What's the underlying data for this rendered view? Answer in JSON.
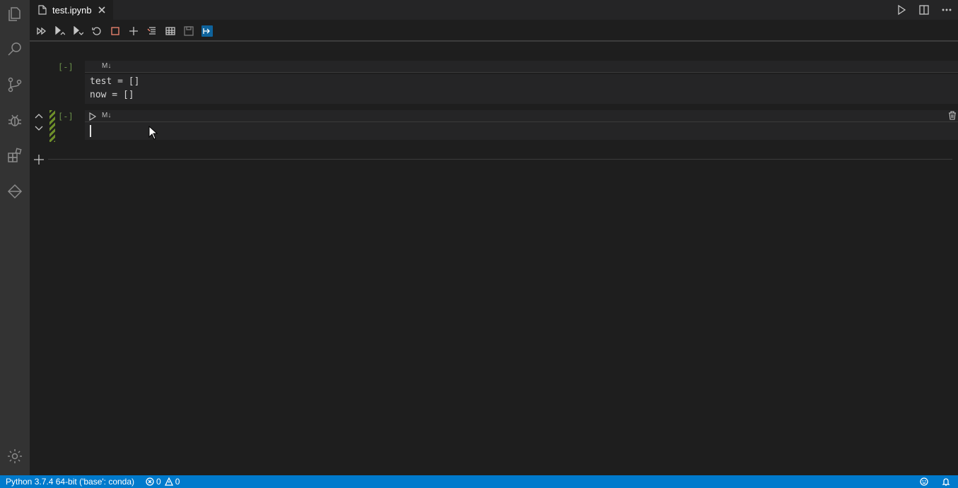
{
  "tab": {
    "filename": "test.ipynb"
  },
  "cells": [
    {
      "prompt": "[-]",
      "type_label": "M↓",
      "lines": [
        "test = []",
        "now = []"
      ]
    },
    {
      "prompt": "[-]",
      "type_label": "M↓",
      "lines": [
        ""
      ]
    }
  ],
  "status": {
    "interpreter": "Python 3.7.4 64-bit ('base': conda)",
    "errors": "0",
    "warnings": "0"
  },
  "colors": {
    "status_bar": "#007acc",
    "activity_bar": "#333333",
    "editor_bg": "#1e1e1e",
    "cell_bg": "#252526",
    "prompt": "#6a8f4a"
  },
  "icons": {
    "activity": [
      "explorer-icon",
      "search-icon",
      "source-control-icon",
      "debug-icon",
      "extensions-icon",
      "remote-explorer-icon",
      "settings-gear-icon"
    ],
    "toolbar": [
      "run-all-icon",
      "run-above-icon",
      "run-below-icon",
      "restart-kernel-icon",
      "interrupt-kernel-icon",
      "add-cell-icon",
      "clear-outputs-icon",
      "variables-icon",
      "save-icon",
      "export-icon"
    ]
  }
}
